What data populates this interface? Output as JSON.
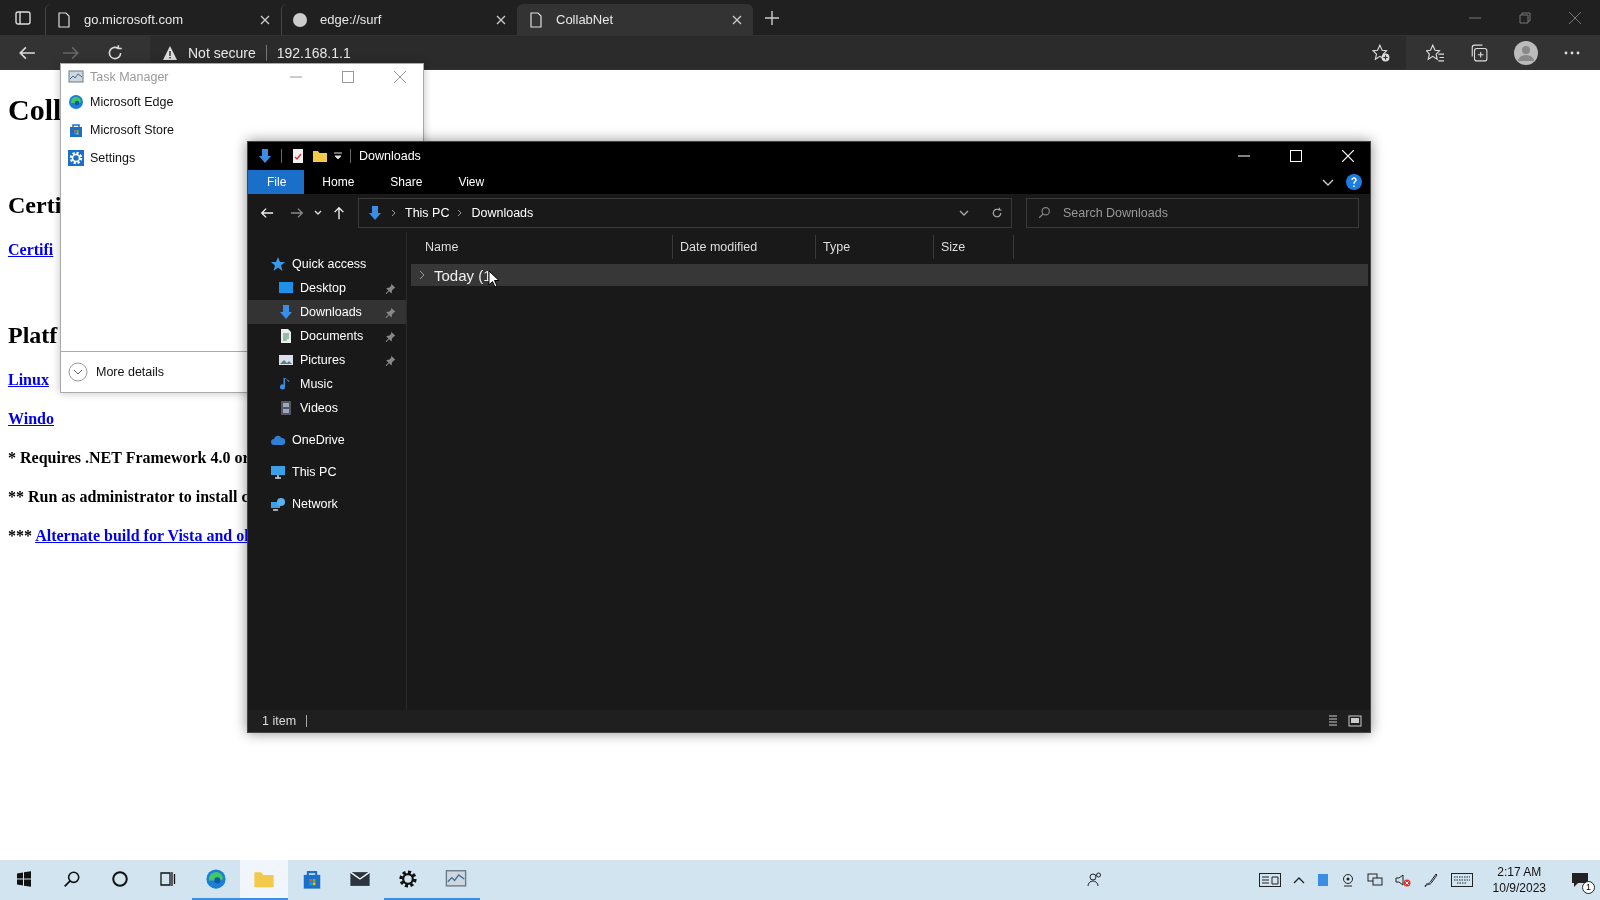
{
  "browser": {
    "tabs": [
      {
        "title": "go.microsoft.com",
        "selected": false
      },
      {
        "title": "edge://surf",
        "selected": false
      },
      {
        "title": "CollabNet",
        "selected": true
      }
    ],
    "address": {
      "security": "Not secure",
      "url": "192.168.1.1"
    }
  },
  "page": [
    {
      "kind": "h1",
      "text": "Coll"
    },
    {
      "kind": "h2",
      "text": "Certi"
    },
    {
      "kind": "link",
      "text": "Certifi"
    },
    {
      "kind": "h2",
      "text": "Platf"
    },
    {
      "kind": "link",
      "text": "Linux"
    },
    {
      "kind": "link",
      "text": "Windo"
    },
    {
      "kind": "note",
      "text": "* Requires .NET Framework 4.0 or"
    },
    {
      "kind": "note",
      "text": "** Run as administrator to install c"
    },
    {
      "kind": "note_link",
      "prefix": "***",
      "text": "Alternate build for Vista and ol"
    }
  ],
  "task_manager": {
    "title": "Task Manager",
    "apps": [
      {
        "name": "Microsoft Edge"
      },
      {
        "name": "Microsoft Store"
      },
      {
        "name": "Settings"
      }
    ],
    "more_details": "More details"
  },
  "explorer": {
    "title": "Downloads",
    "ribbon_tabs": [
      {
        "label": "File",
        "selected": true
      },
      {
        "label": "Home",
        "selected": false
      },
      {
        "label": "Share",
        "selected": false
      },
      {
        "label": "View",
        "selected": false
      }
    ],
    "path": [
      "This PC",
      "Downloads"
    ],
    "search": {
      "placeholder": "Search Downloads"
    },
    "columns": [
      "Name",
      "Date modified",
      "Type",
      "Size"
    ],
    "sidebar": [
      {
        "label": "Quick access",
        "selected": false,
        "children": [
          {
            "label": "Desktop",
            "pinned": true,
            "selected": false
          },
          {
            "label": "Downloads",
            "pinned": true,
            "selected": true
          },
          {
            "label": "Documents",
            "pinned": true,
            "selected": false
          },
          {
            "label": "Pictures",
            "pinned": true,
            "selected": false
          },
          {
            "label": "Music",
            "pinned": false,
            "selected": false
          },
          {
            "label": "Videos",
            "pinned": false,
            "selected": false
          }
        ]
      },
      {
        "label": "OneDrive",
        "selected": false
      },
      {
        "label": "This PC",
        "selected": false
      },
      {
        "label": "Network",
        "selected": false
      }
    ],
    "groups": [
      {
        "label": "Today (1",
        "expanded": false
      }
    ],
    "status": "1 item"
  },
  "taskbar": {
    "apps": [
      {
        "open": true,
        "selected": false
      },
      {
        "open": true,
        "selected": true
      },
      {
        "open": false,
        "selected": false
      },
      {
        "open": false,
        "selected": false
      },
      {
        "open": true,
        "selected": false
      },
      {
        "open": true,
        "selected": false
      }
    ],
    "clock": {
      "time": "2:17 AM",
      "date": "10/9/2023"
    },
    "notifications": "1"
  }
}
